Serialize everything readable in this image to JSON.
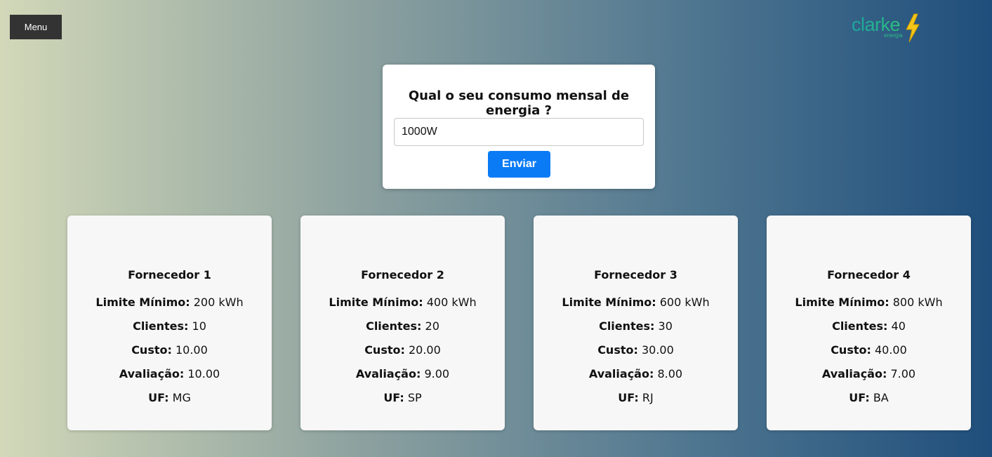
{
  "header": {
    "menu_label": "Menu",
    "logo": {
      "word": "clarke",
      "sub": "energia",
      "icon": "lightning-bolt-icon"
    }
  },
  "form": {
    "title": "Qual o seu consumo mensal de energia ?",
    "input_value": "1000W",
    "submit_label": "Enviar"
  },
  "labels": {
    "limit": "Limite Mínimo:",
    "clients": "Clientes:",
    "cost": "Custo:",
    "rating": "Avaliação:",
    "uf": "UF:"
  },
  "suppliers": [
    {
      "name": "Fornecedor 1",
      "limit": "200 kWh",
      "clients": "10",
      "cost": "10.00",
      "rating": "10.00",
      "uf": "MG"
    },
    {
      "name": "Fornecedor 2",
      "limit": "400 kWh",
      "clients": "20",
      "cost": "20.00",
      "rating": "9.00",
      "uf": "SP"
    },
    {
      "name": "Fornecedor 3",
      "limit": "600 kWh",
      "clients": "30",
      "cost": "30.00",
      "rating": "8.00",
      "uf": "RJ"
    },
    {
      "name": "Fornecedor 4",
      "limit": "800 kWh",
      "clients": "40",
      "cost": "40.00",
      "rating": "7.00",
      "uf": "BA"
    }
  ],
  "colors": {
    "accent": "#0a7bf5",
    "menu_bg": "#333333",
    "card_bg": "#f7f7f7",
    "logo_green": "#2bbd86",
    "logo_bolt": "#f5c518"
  }
}
